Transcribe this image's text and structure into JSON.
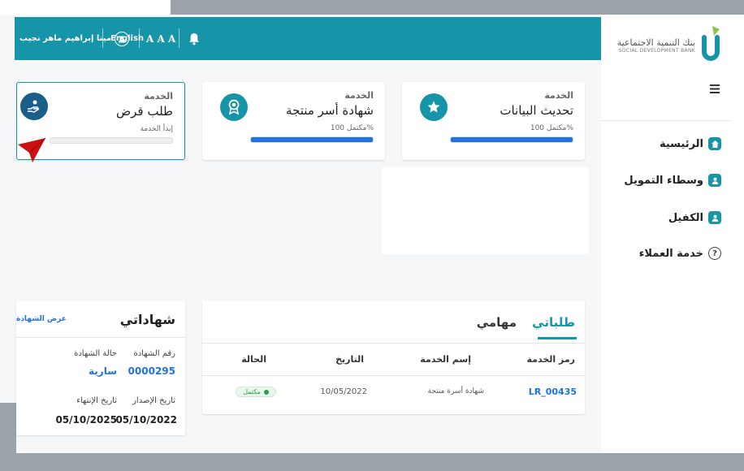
{
  "brand": {
    "name_ar": "بنك التنمية الاجتماعية",
    "name_en": "SOCIAL DEVELOPMENT BANK",
    "color": "#1795a8"
  },
  "header": {
    "user_name": "مينا إبراهيم ماهر نجيب",
    "language": "English",
    "font_sizes": "A A A",
    "icons": {
      "bell": "bell-icon",
      "user": "user-icon"
    }
  },
  "sidebar": {
    "menu_icon": "hamburger-icon",
    "items": [
      {
        "label": "الرئيسية",
        "icon": "home-icon"
      },
      {
        "label": "وسطاء التمويل",
        "icon": "user-card-icon"
      },
      {
        "label": "الكفيل",
        "icon": "user-card-icon"
      },
      {
        "label": "خدمة العملاء",
        "icon": "question-icon"
      }
    ]
  },
  "services": [
    {
      "label": "الخدمة",
      "title": "تحديث البيانات",
      "status": "مكتمل 100%",
      "progress": 1.0,
      "icon": "star-icon"
    },
    {
      "label": "الخدمة",
      "title": "شهادة أسر منتجة",
      "status": "مكتمل 100%",
      "progress": 1.0,
      "icon": "award-icon"
    },
    {
      "label": "الخدمة",
      "title": "طلب قرض",
      "status": "إبدأ الخدمة",
      "progress": 0.0,
      "icon": "money-hand-icon"
    }
  ],
  "requests": {
    "tabs": [
      {
        "label": "طلباتي",
        "active": true
      },
      {
        "label": "مهامي",
        "active": false
      }
    ],
    "columns": [
      "رمز الخدمة",
      "إسم الخدمة",
      "التاريخ",
      "الحالة"
    ],
    "rows": [
      {
        "code": "LR_00435",
        "name": "شهادة أسرة منتجة",
        "date": "10/05/2022",
        "status": "مكتمل"
      }
    ]
  },
  "certificates": {
    "title": "شهاداتي",
    "view_all": "عرض الشهادة",
    "cert_number_label": "رقم الشهادة",
    "cert_number": "0000295",
    "status_label": "حالة الشهادة",
    "status": "سارية",
    "issue_label": "تاريخ الإصدار",
    "issue_date": "05/10/2022",
    "expiry_label": "تاريخ الإنتهاء",
    "expiry_date": "05/10/2025"
  },
  "colors": {
    "accent": "#1795a8",
    "progress": "#1f72e6",
    "link": "#1f72e6",
    "status_green": "#2e9d47",
    "arrow_red": "#cc1111"
  }
}
